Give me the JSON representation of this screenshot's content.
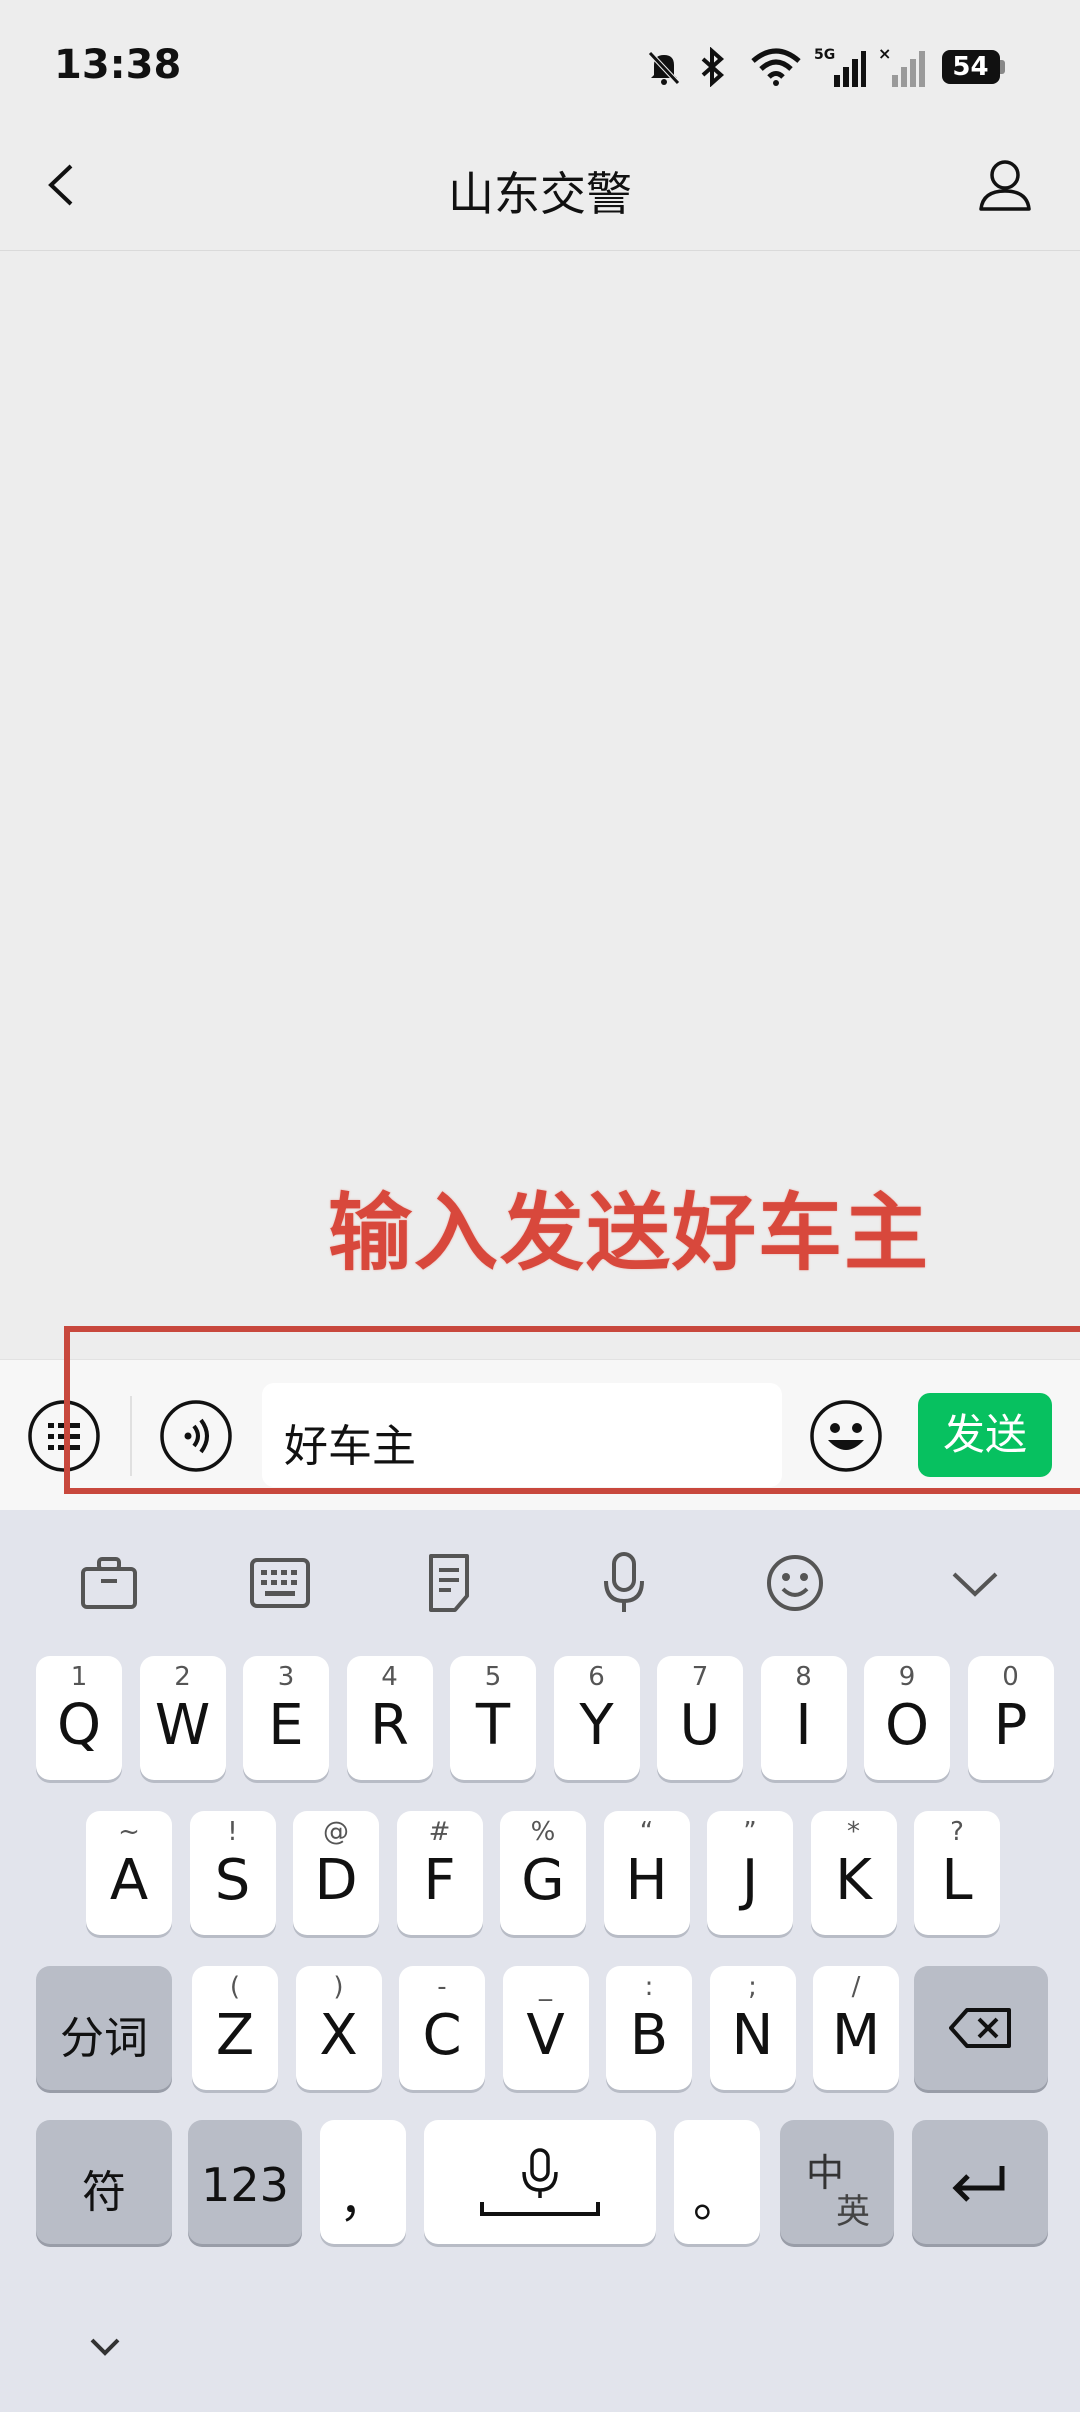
{
  "status_bar": {
    "time": "13:38",
    "battery": "54",
    "network": "5G"
  },
  "header": {
    "title": "山东交警"
  },
  "annotation": {
    "text": "输入发送好车主"
  },
  "input_bar": {
    "message": "好车主",
    "send_label": "发送"
  },
  "keyboard": {
    "row1": [
      {
        "k": "Q",
        "s": "1"
      },
      {
        "k": "W",
        "s": "2"
      },
      {
        "k": "E",
        "s": "3"
      },
      {
        "k": "R",
        "s": "4"
      },
      {
        "k": "T",
        "s": "5"
      },
      {
        "k": "Y",
        "s": "6"
      },
      {
        "k": "U",
        "s": "7"
      },
      {
        "k": "I",
        "s": "8"
      },
      {
        "k": "O",
        "s": "9"
      },
      {
        "k": "P",
        "s": "0"
      }
    ],
    "row2": [
      {
        "k": "A",
        "s": "~"
      },
      {
        "k": "S",
        "s": "!"
      },
      {
        "k": "D",
        "s": "@"
      },
      {
        "k": "F",
        "s": "#"
      },
      {
        "k": "G",
        "s": "%"
      },
      {
        "k": "H",
        "s": "“"
      },
      {
        "k": "J",
        "s": "”"
      },
      {
        "k": "K",
        "s": "*"
      },
      {
        "k": "L",
        "s": "?"
      }
    ],
    "row3": [
      {
        "k": "Z",
        "s": "("
      },
      {
        "k": "X",
        "s": ")"
      },
      {
        "k": "C",
        "s": "-"
      },
      {
        "k": "V",
        "s": "_"
      },
      {
        "k": "B",
        "s": ":"
      },
      {
        "k": "N",
        "s": ";"
      },
      {
        "k": "M",
        "s": "/"
      }
    ],
    "segment_label": "分词",
    "symbols_label": "符",
    "numbers_label": "123",
    "comma_label": "，",
    "period_label": "。",
    "lang_primary": "中",
    "lang_secondary": "英"
  },
  "colors": {
    "send": "#07c160",
    "annotation": "#d8483c",
    "redbox": "#c8483d",
    "keyboard_bg": "#e2e4ec"
  }
}
